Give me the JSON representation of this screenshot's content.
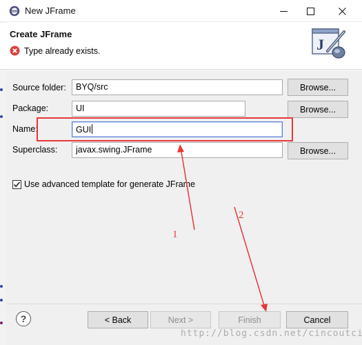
{
  "window": {
    "title": "New JFrame"
  },
  "banner": {
    "title": "Create JFrame",
    "message": "Type already exists.",
    "icon_letter": "J"
  },
  "form": {
    "source_folder": {
      "label": "Source folder:",
      "value": "BYQ/src",
      "browse": "Browse..."
    },
    "package": {
      "label": "Package:",
      "value": "UI",
      "browse": "Browse..."
    },
    "name": {
      "label": "Name:",
      "value": "GUI"
    },
    "superclass": {
      "label": "Superclass:",
      "value": "javax.swing.JFrame",
      "browse": "Browse..."
    },
    "advanced_template": {
      "label": "Use advanced template for generate JFrame",
      "checked": true
    }
  },
  "footer": {
    "help": "?",
    "back": "< Back",
    "next": "Next >",
    "finish": "Finish",
    "cancel": "Cancel"
  },
  "annotations": {
    "num1": "1",
    "num2": "2"
  },
  "watermark": "http://blog.csdn.net/cincoutcin",
  "colors": {
    "annotation": "#e8363a",
    "error": "#d9413b"
  }
}
